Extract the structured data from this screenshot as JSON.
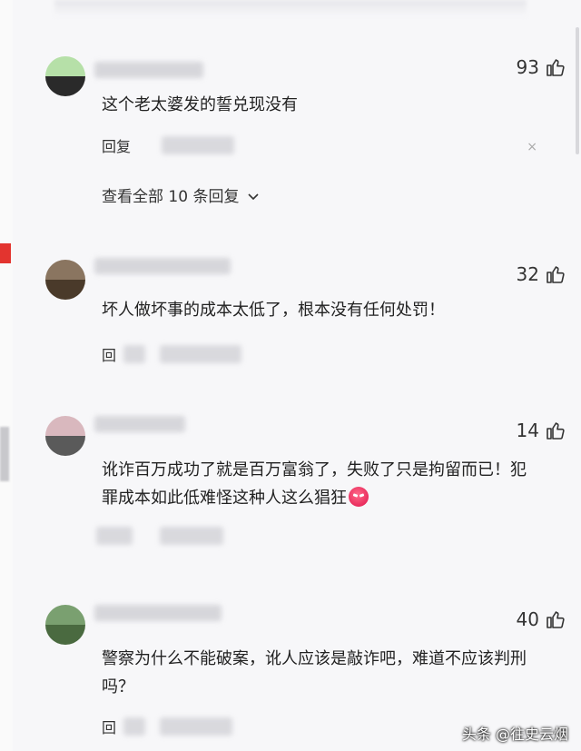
{
  "comments": [
    {
      "likes": "93",
      "text": "这个老太婆发的誓兑现没有",
      "reply_label": "回复",
      "view_all": "查看全部 10 条回复",
      "avatar_colors": [
        "#b6e0a8",
        "#2a2a2a"
      ]
    },
    {
      "likes": "32",
      "text": "坏人做坏事的成本太低了，根本没有任何处罚！",
      "reply_label": "回",
      "avatar_colors": [
        "#8a7560",
        "#4a3a2a"
      ]
    },
    {
      "likes": "14",
      "text": "讹诈百万成功了就是百万富翁了，失败了只是拘留而已！犯罪成本如此低难怪这种人这么猖狂",
      "reply_label": "",
      "avatar_colors": [
        "#d9b8be",
        "#5a5a5a"
      ]
    },
    {
      "likes": "40",
      "text": "警察为什么不能破案，讹人应该是敲诈吧，难道不应该判刑吗？",
      "reply_label": "回",
      "avatar_colors": [
        "#7aa070",
        "#4a6a40"
      ]
    }
  ],
  "icons": {
    "like": "thumb-up-icon",
    "close": "close-icon",
    "chevron": "chevron-down-icon",
    "emoji": "angry-face-icon"
  },
  "close_glyph": "×",
  "watermark": "头条 @往史云烟"
}
